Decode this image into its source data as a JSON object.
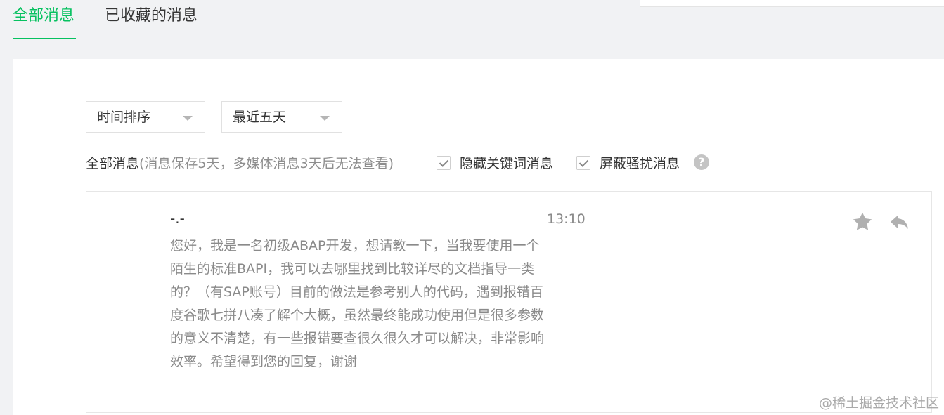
{
  "tabs": [
    {
      "label": "全部消息",
      "active": true,
      "accent": "#07c160"
    },
    {
      "label": "已收藏的消息",
      "active": false
    }
  ],
  "filters": {
    "time_sort": "时间排序",
    "range": "最近五天"
  },
  "summary": {
    "title": "全部消息",
    "note": "(消息保存5天，多媒体消息3天后无法查看)"
  },
  "options": {
    "hide_keyword_messages": {
      "label": "隐藏关键词消息",
      "checked": true
    },
    "block_spam_messages": {
      "label": "屏蔽骚扰消息",
      "checked": true
    },
    "help": "?"
  },
  "message": {
    "sender": "-.-",
    "time": "13:10",
    "body": "您好，我是一名初级ABAP开发，想请教一下，当我要使用一个陌生的标准BAPI，我可以去哪里找到比较详尽的文档指导一类的？（有SAP账号）目前的做法是参考别人的代码，遇到报错百度谷歌七拼八凑了解个大概，虽然最终能成功使用但是很多参数的意义不清楚，有一些报错要查很久很久才可以解决，非常影响效率。希望得到您的回复，谢谢",
    "actions": {
      "star_icon": "star-icon",
      "reply_icon": "reply-icon"
    }
  },
  "watermark": "@稀土掘金技术社区",
  "colors": {
    "green": "#07c160",
    "text": "#333333",
    "muted": "#8a8a8a",
    "background": "#f1f2f4",
    "icon": "#b0b0b0"
  }
}
